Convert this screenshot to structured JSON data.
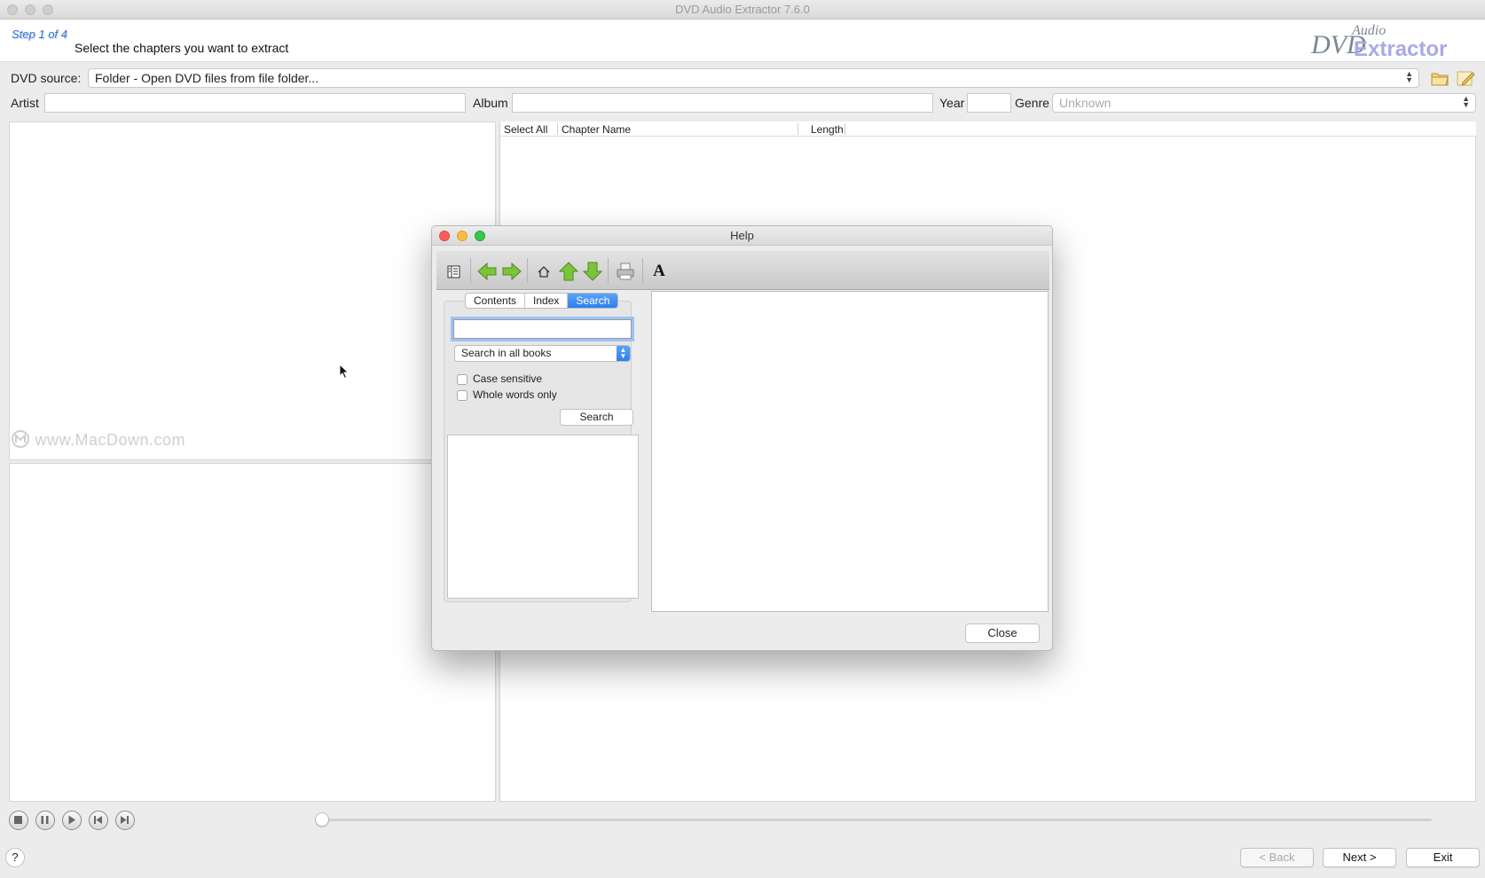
{
  "window": {
    "title": "DVD Audio Extractor 7.6.0"
  },
  "header": {
    "step": "Step 1 of 4",
    "instruction": "Select the chapters you want to extract",
    "logo": {
      "line1": "DVD",
      "line2": "Audio",
      "line3": "Extractor"
    }
  },
  "source": {
    "label": "DVD source:",
    "value": "Folder - Open DVD files from file folder..."
  },
  "metadata": {
    "artist_label": "Artist",
    "artist_value": "",
    "album_label": "Album",
    "album_value": "",
    "year_label": "Year",
    "year_value": "",
    "genre_label": "Genre",
    "genre_value": "Unknown"
  },
  "chapter_list": {
    "columns": [
      "Select All",
      "Chapter Name",
      "Length"
    ],
    "rows": []
  },
  "watermark": "www.MacDown.com",
  "footer": {
    "help_label": "?",
    "back_label": "< Back",
    "next_label": "Next >",
    "exit_label": "Exit"
  },
  "help_dialog": {
    "title": "Help",
    "tabs": [
      "Contents",
      "Index",
      "Search"
    ],
    "active_tab": "Search",
    "search_value": "",
    "scope_value": "Search in all books",
    "case_sensitive_label": "Case sensitive",
    "whole_words_label": "Whole words only",
    "search_button": "Search",
    "close_button": "Close",
    "toolbar_font_glyph": "A"
  },
  "colors": {
    "accent": "#2c7ff0",
    "step_text": "#3a77d6",
    "logo_purple": "#a9a9e6",
    "nav_arrow_green": "#7cc43a"
  }
}
